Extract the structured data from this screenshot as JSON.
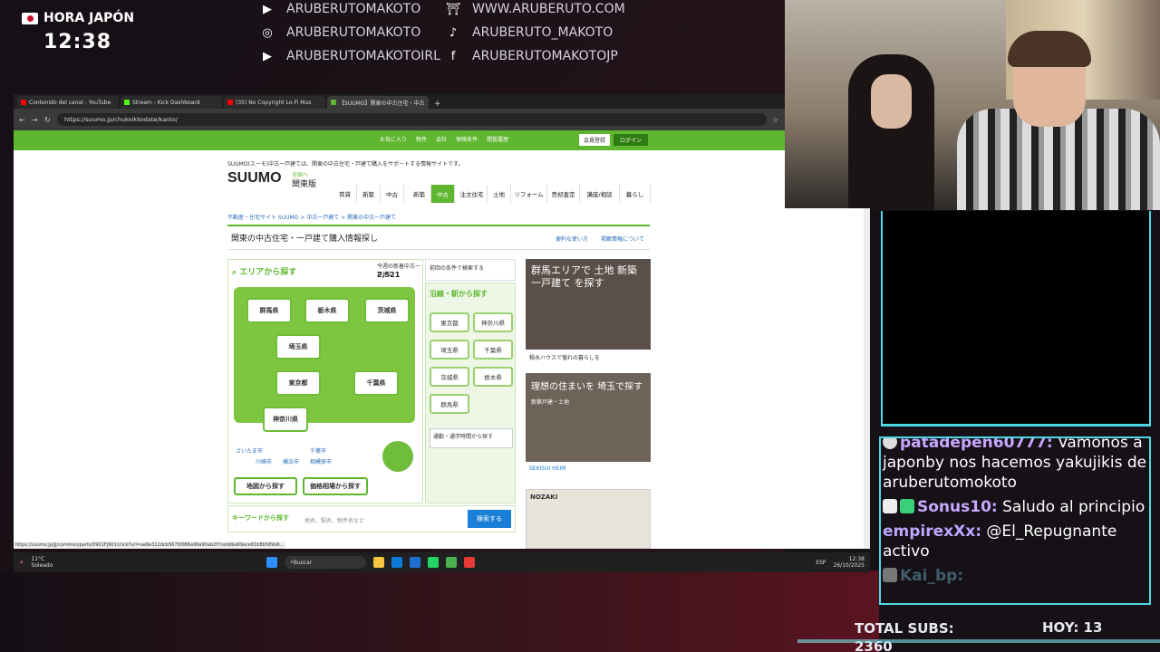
{
  "overlay": {
    "clock_label": "HORA JAPÓN",
    "clock_time": "12:38",
    "socials_left": [
      "ARUBERUTOMAKOTO",
      "ARUBERUTOMAKOTO",
      "ARUBERUTOMAKOTOIRL"
    ],
    "socials_right": [
      "WWW.ARUBERUTO.COM",
      "ARUBERUTO_MAKOTO",
      "ARUBERUTOMAKOTOJP"
    ],
    "total_subs_label": "TOTAL SUBS:",
    "total_subs_value": "2360",
    "hoy_label": "HOY: 13",
    "accent_color": "#4dd8e4"
  },
  "chat": {
    "messages": [
      {
        "user": "patadepen60777:",
        "text": "Vamonos a japonby nos hacemos yakujikis de aruberutomokoto"
      },
      {
        "user": "Sonus10:",
        "text": "Saludo al principio"
      },
      {
        "user": "empirexXx:",
        "text": "@El_Repugnante activo"
      },
      {
        "user": "Kai_bp:",
        "text": ""
      }
    ]
  },
  "browser": {
    "tabs": [
      "Contenido del canal - YouTube",
      "Stream - Kick Dashboard",
      "(35) No Copyright Lo-Fi Mus",
      "【SUUMO】関東の中古住宅・中古"
    ],
    "url": "https://suumo.jp/chukoikkodate/kanto/",
    "status_url": "https://suumo.jp/jj/common/parts/0901FJ901/click?url=ae6e312dcb5675f086a96a90ab2f7ceddba69ace81b8b589b6...",
    "top_links": [
      "お気に入り",
      "物件",
      "会社",
      "保険条件",
      "閲覧履歴",
      "会員登録",
      "ログイン"
    ]
  },
  "suumo": {
    "tagline": "SUUMO(スーモ)中古一戸建ては、関東の中古住宅・戸建て購入をサポートする情報サイトです。",
    "logo": "SUUMO",
    "region_link": "全国へ",
    "region": "関東版",
    "nav": [
      "賃貸",
      "新築",
      "中古",
      "新築",
      "中古",
      "注文住宅",
      "土地",
      "リフォーム",
      "売却査定",
      "講座/相談",
      "暮らし"
    ],
    "breadcrumb": "不動産・住宅サイト SUUMO > 中古一戸建て > 関東の中古一戸建て",
    "page_title": "関東の中古住宅・一戸建て購入情報探し",
    "help_links": [
      "便利な使い方",
      "掲載情報について"
    ],
    "area_search": "エリアから探す",
    "count_label": "今週の新着中古一戸建て",
    "count": "2,521",
    "recent_search": "前回の条件で検索する",
    "prefectures": [
      "群馬県",
      "栃木県",
      "茨城県",
      "埼玉県",
      "東京都",
      "千葉県",
      "神奈川県"
    ],
    "rail_title": "沿線・駅から探す",
    "rail_prefs": [
      "東京都",
      "神奈川県",
      "埼玉県",
      "千葉県",
      "茨城県",
      "栃木県",
      "群馬県"
    ],
    "commute": "通勤・通学時間から探す",
    "map_search": "地図から探す",
    "price_search": "価格相場から探す",
    "keyword_label": "キーワードから探す",
    "keyword_placeholder": "地名、駅名、物件名など",
    "search_button": "検索する",
    "ad1": {
      "title": "群馬エリアで 土地 新築一戸建て を探す",
      "footer": "積水ハウスで憧れの暮らしを"
    },
    "ad2": {
      "title": "理想の住まいを 埼玉で探す",
      "sub": "新築戸建・土地",
      "footer": "SEKISUI HEIM"
    },
    "ad3": {
      "title": "NOZAKI"
    },
    "sublinks": [
      "さいたま市",
      "千葉市",
      "川崎市",
      "横浜市",
      "相模原市"
    ]
  },
  "taskbar": {
    "weather": "11°C",
    "weather_sub": "Soleado",
    "search": "Buscar",
    "lang": "ESP",
    "time": "12:38",
    "date": "26/10/2025"
  }
}
